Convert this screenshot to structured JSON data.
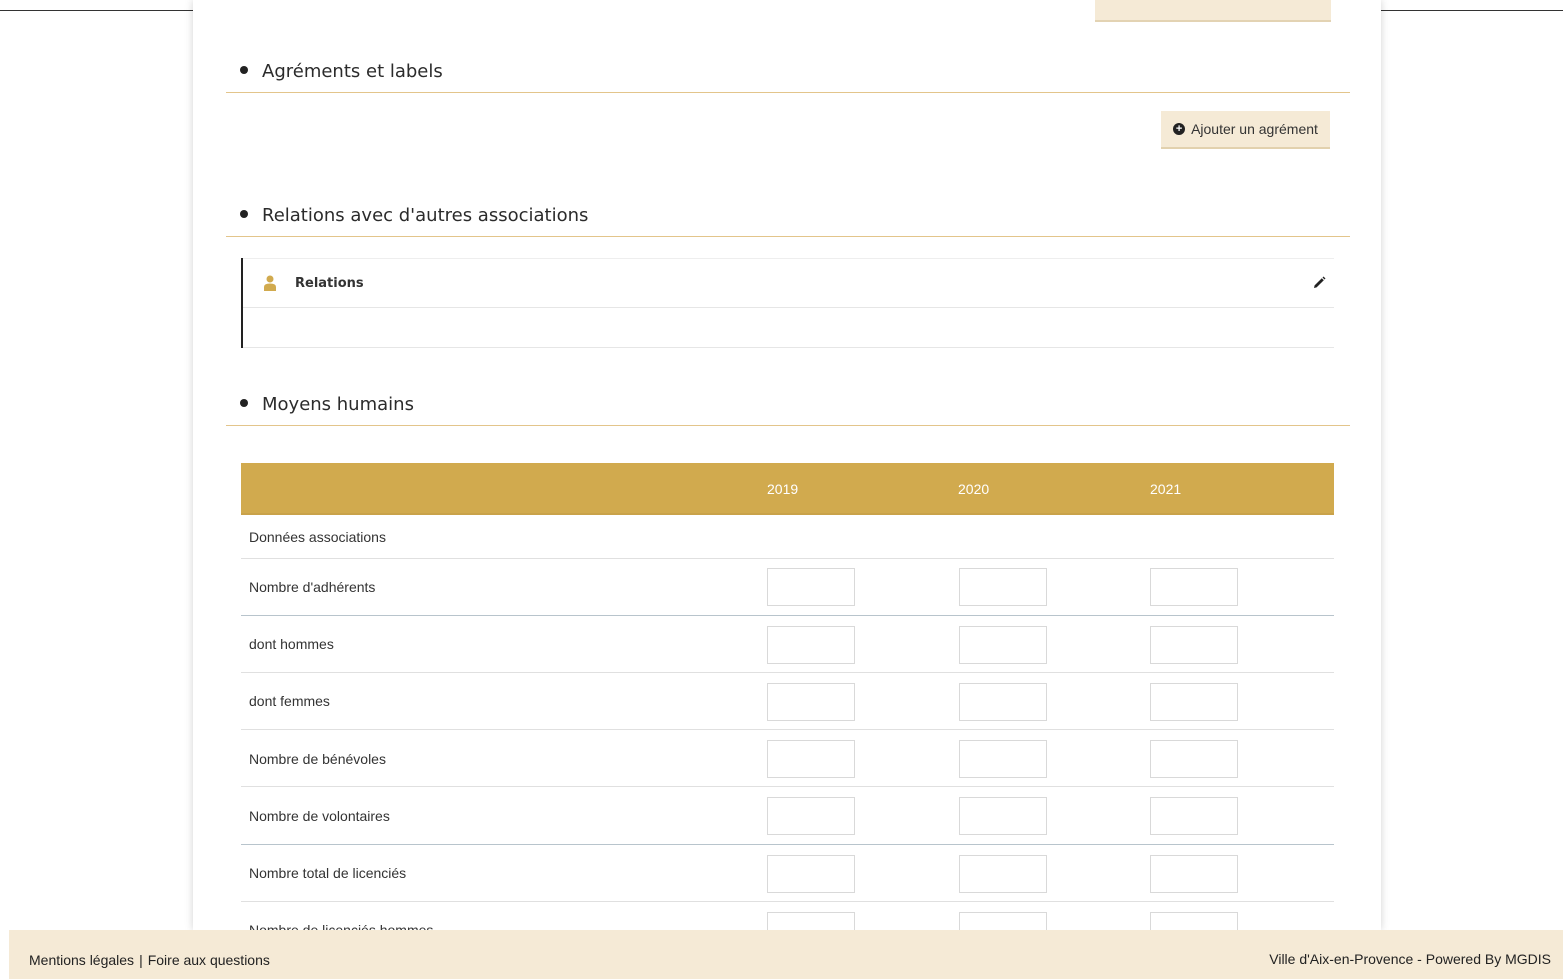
{
  "sections": {
    "agrements": {
      "title": "Agréments et labels",
      "add_button": "Ajouter un agrément"
    },
    "relations": {
      "title": "Relations avec d'autres associations",
      "card_label": "Relations"
    },
    "moyens": {
      "title": "Moyens humains"
    }
  },
  "table": {
    "years": [
      "2019",
      "2020",
      "2021"
    ],
    "group_label": "Données associations",
    "rows": [
      "Nombre d'adhérents",
      "dont hommes",
      "dont femmes",
      "Nombre de bénévoles",
      "Nombre de volontaires",
      "Nombre total de licenciés",
      "Nombre de licenciés hommes"
    ]
  },
  "footer": {
    "legal": "Mentions légales",
    "separator": "|",
    "faq": "Foire aux questions",
    "credit": "Ville d'Aix-en-Provence - Powered By MGDIS"
  },
  "icons": {
    "add": "plus-circle-icon",
    "person": "user-icon",
    "edit": "pencil-icon"
  },
  "colors": {
    "accent": "#d1aa4e",
    "button_bg": "#f5ead6",
    "rule": "#e3c58b"
  }
}
